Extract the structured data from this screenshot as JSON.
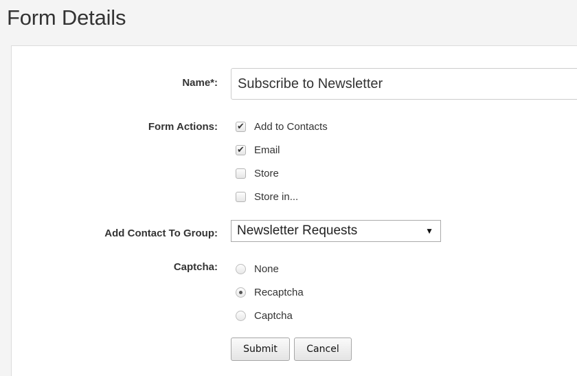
{
  "page": {
    "title": "Form Details"
  },
  "form": {
    "name": {
      "label": "Name*:",
      "value": "Subscribe to Newsletter"
    },
    "form_actions": {
      "label": "Form Actions:",
      "options": [
        {
          "label": "Add to Contacts",
          "checked": true
        },
        {
          "label": "Email",
          "checked": true
        },
        {
          "label": "Store",
          "checked": false
        },
        {
          "label": "Store in...",
          "checked": false
        }
      ]
    },
    "group": {
      "label": "Add Contact To Group:",
      "selected": "Newsletter Requests"
    },
    "captcha": {
      "label": "Captcha:",
      "options": [
        {
          "label": "None",
          "selected": false
        },
        {
          "label": "Recaptcha",
          "selected": true
        },
        {
          "label": "Captcha",
          "selected": false
        }
      ]
    },
    "buttons": {
      "submit": "Submit",
      "cancel": "Cancel"
    }
  },
  "icons": {
    "checkmark": "check-mark-icon",
    "dropdown": "triangle-down-icon"
  }
}
